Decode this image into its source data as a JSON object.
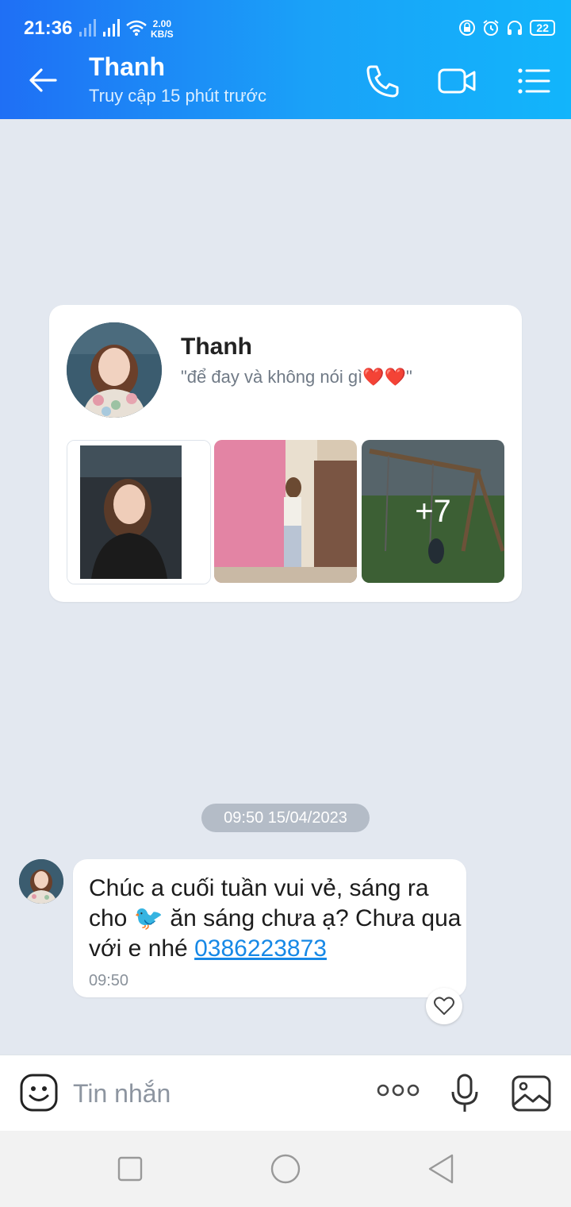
{
  "status_bar": {
    "time": "21:36",
    "net_speed": "2.00",
    "net_unit": "KB/S",
    "battery": "22"
  },
  "header": {
    "title": "Thanh",
    "subtitle": "Truy cập 15 phút trước",
    "icons": [
      "back-arrow-icon",
      "phone-icon",
      "video-call-icon",
      "menu-list-icon"
    ]
  },
  "profile_card": {
    "name": "Thanh",
    "status": "\"để đay và không nói gì❤️❤️\"",
    "photos_more": "+7"
  },
  "conversation": {
    "date_separator": "09:50 15/04/2023",
    "message": {
      "text_before": "Chúc a cuối tuần vui vẻ, sáng ra cho 🐦 ăn sáng chưa ạ? Chưa qua với e nhé ",
      "phone_link": "0386223873",
      "time": "09:50"
    }
  },
  "input_bar": {
    "placeholder": "Tin nhắn",
    "icons": [
      "emoji-icon",
      "more-options-icon",
      "microphone-icon",
      "gallery-icon"
    ]
  },
  "nav_bar": {
    "icons": [
      "recent-apps-icon",
      "home-icon",
      "back-icon"
    ]
  },
  "colors": {
    "header_start": "#1f6ff5",
    "header_end": "#12b5fb",
    "link": "#1688e6",
    "background": "#e3e8f0"
  }
}
